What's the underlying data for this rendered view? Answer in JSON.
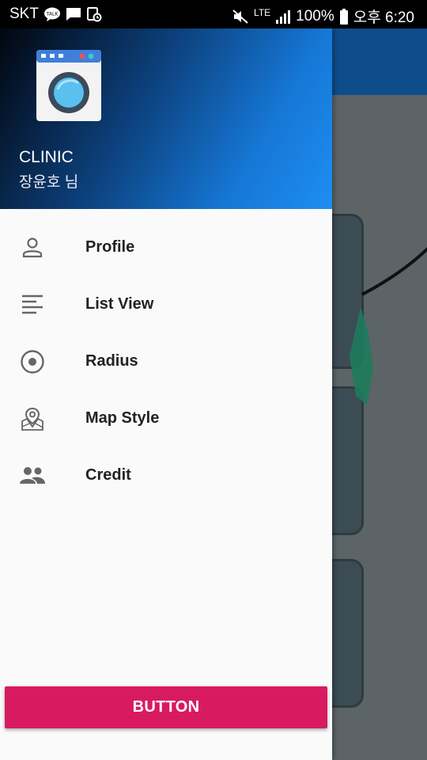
{
  "status_bar": {
    "carrier": "SKT",
    "network": "LTE",
    "battery": "100%",
    "time": "오후 6:20",
    "icons": [
      "kakaotalk-icon",
      "message-icon",
      "screenshot-icon",
      "mute-icon",
      "signal-icon",
      "battery-icon"
    ]
  },
  "drawer": {
    "header": {
      "logo": "washing-machine-icon",
      "title": "CLINIC",
      "subtitle": "장윤호 님"
    },
    "menu": [
      {
        "label": "Profile",
        "icon": "person-icon"
      },
      {
        "label": "List View",
        "icon": "list-icon"
      },
      {
        "label": "Radius",
        "icon": "radio-target-icon"
      },
      {
        "label": "Map Style",
        "icon": "map-pin-icon"
      },
      {
        "label": "Credit",
        "icon": "people-icon"
      }
    ],
    "button_label": "BUTTON"
  },
  "colors": {
    "accent": "#d81b60",
    "header_start": "#02060e",
    "header_end": "#1d8ef2",
    "app_bar": "#0f4c8c"
  }
}
